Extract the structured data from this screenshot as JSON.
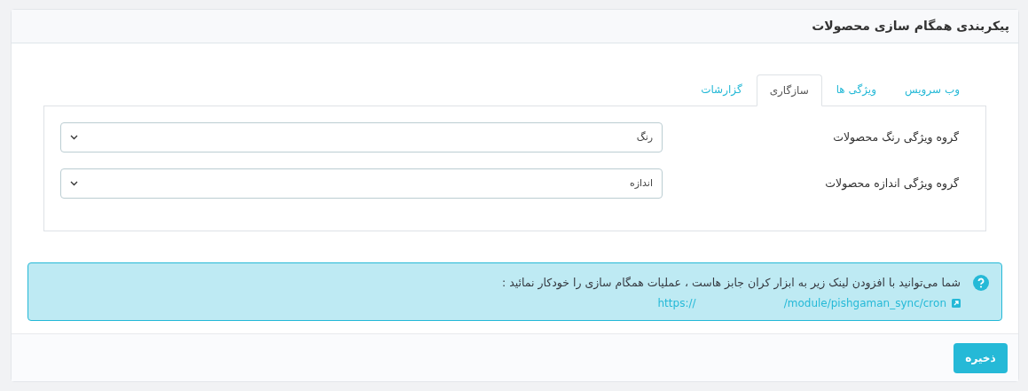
{
  "panel": {
    "title": "پیکربندی همگام سازی محصولات"
  },
  "tabs": [
    {
      "label": "وب سرویس",
      "selected": false
    },
    {
      "label": "ویژگی ها",
      "selected": false
    },
    {
      "label": "سازگاری",
      "selected": true
    },
    {
      "label": "گزارشات",
      "selected": false
    }
  ],
  "fields": [
    {
      "label": "گروه ویژگی رنگ محصولات",
      "value": "رنگ"
    },
    {
      "label": "گروه ویژگی اندازه محصولات",
      "value": "اندازه"
    }
  ],
  "alert": {
    "text": "شما می‌توانید با افزودن لینک زیر به ابزار کران جابز هاست ، عملیات همگام سازی را خودکار نمائید :",
    "link": "https://                          /module/pishgaman_sync/cron"
  },
  "save_button": "ذخیره"
}
